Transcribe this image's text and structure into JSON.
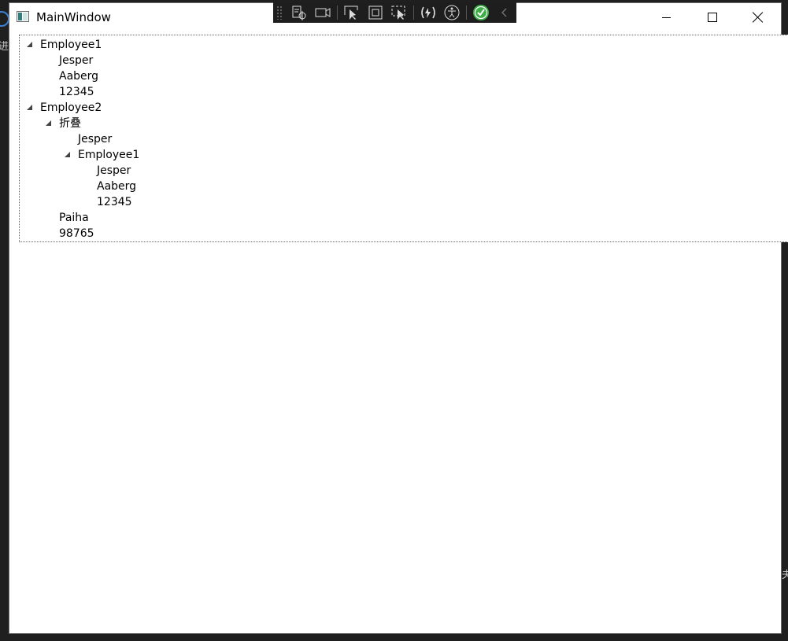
{
  "window": {
    "title": "MainWindow"
  },
  "background": {
    "left_glyph_1": "进",
    "right_glyph_1": "夫"
  },
  "debug_toolbar": {
    "tools": [
      "select-element-icon",
      "video-icon",
      "pointer-select-icon",
      "layout-adorner-icon",
      "track-focus-icon",
      "hot-reload-icon",
      "accessibility-icon",
      "binding-ok-icon",
      "collapse-chevron-icon"
    ]
  },
  "tree": {
    "nodes": [
      {
        "label": "Employee1",
        "expandable": true,
        "expanded": true,
        "level": 0
      },
      {
        "label": "Jesper",
        "expandable": false,
        "level": 1
      },
      {
        "label": "Aaberg",
        "expandable": false,
        "level": 1
      },
      {
        "label": "12345",
        "expandable": false,
        "level": 1
      },
      {
        "label": "Employee2",
        "expandable": true,
        "expanded": true,
        "level": 0
      },
      {
        "label": "折叠",
        "expandable": true,
        "expanded": true,
        "level": 1
      },
      {
        "label": "Jesper",
        "expandable": false,
        "level": 2
      },
      {
        "label": "Employee1",
        "expandable": true,
        "expanded": true,
        "level": 2
      },
      {
        "label": "Jesper",
        "expandable": false,
        "level": 3
      },
      {
        "label": "Aaberg",
        "expandable": false,
        "level": 3
      },
      {
        "label": "12345",
        "expandable": false,
        "level": 3
      },
      {
        "label": "Paiha",
        "expandable": false,
        "level": 1
      },
      {
        "label": "98765",
        "expandable": false,
        "level": 1
      }
    ]
  },
  "colors": {
    "window_bg": "#ffffff",
    "toolbar_bg": "#1e1e1e",
    "check_green": "#3fae49"
  }
}
